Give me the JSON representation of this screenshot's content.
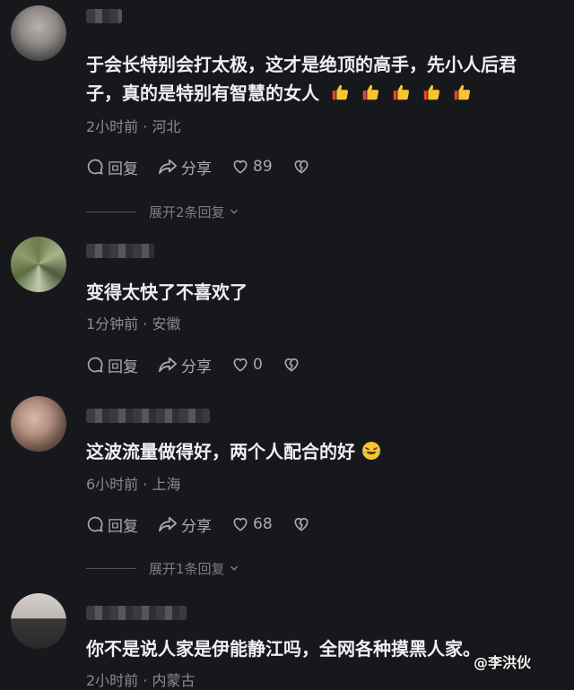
{
  "comments": [
    {
      "text": "于会长特别会打太极，这才是绝顶的高手，先小人后君子，真的是特别有智慧的女人",
      "emojis": [
        "thumbs-up-icon",
        "thumbs-up-icon",
        "thumbs-up-icon",
        "thumbs-up-icon",
        "thumbs-up-icon"
      ],
      "meta": "2小时前 · 河北",
      "reply_label": "回复",
      "share_label": "分享",
      "likes": "89",
      "expand_label": "展开2条回复"
    },
    {
      "text": "变得太快了不喜欢了",
      "meta": "1分钟前 · 安徽",
      "reply_label": "回复",
      "share_label": "分享",
      "likes": "0"
    },
    {
      "text": "这波流量做得好，两个人配合的好",
      "emojis": [
        "laughing-tears-icon"
      ],
      "meta": "6小时前 · 上海",
      "reply_label": "回复",
      "share_label": "分享",
      "likes": "68",
      "expand_label": "展开1条回复"
    },
    {
      "text": "你不是说人家是伊能静江吗，全网各种摸黑人家。",
      "meta": "2小时前 · 内蒙古"
    }
  ],
  "watermark": {
    "label": "@李洪伙"
  },
  "colors": {
    "background": "#17181c",
    "text": "#efeff2",
    "muted": "#8a8b92",
    "emoji_yellow": "#f7c531",
    "emoji_red": "#e8452f"
  }
}
